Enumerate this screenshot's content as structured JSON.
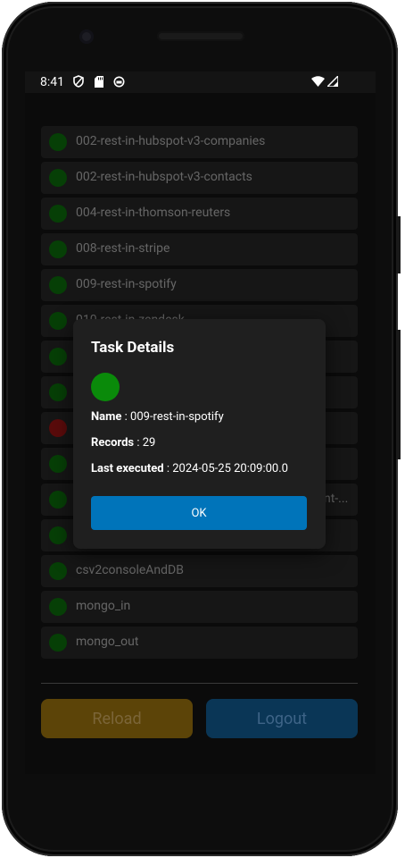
{
  "statusbar": {
    "time": "8:41",
    "icons": [
      "shield-icon",
      "sd-card-icon",
      "cloud-sync-icon",
      "wifi-icon",
      "cell-signal-icon"
    ]
  },
  "tasks": [
    {
      "label": "002-rest-in-hubspot-v3-companies",
      "status": "ok"
    },
    {
      "label": "002-rest-in-hubspot-v3-contacts",
      "status": "ok"
    },
    {
      "label": "004-rest-in-thomson-reuters",
      "status": "ok"
    },
    {
      "label": "008-rest-in-stripe",
      "status": "ok"
    },
    {
      "label": "009-rest-in-spotify",
      "status": "ok"
    },
    {
      "label": "010-rest-in-zendesk",
      "status": "ok"
    },
    {
      "label": "",
      "status": "ok"
    },
    {
      "label": "",
      "status": "ok"
    },
    {
      "label": "",
      "status": "error"
    },
    {
      "label": "",
      "status": "ok"
    },
    {
      "label": "nt-...",
      "status": "ok"
    },
    {
      "label": "",
      "status": "ok"
    },
    {
      "label": "csv2consoleAndDB",
      "status": "ok"
    },
    {
      "label": "mongo_in",
      "status": "ok"
    },
    {
      "label": "mongo_out",
      "status": "ok"
    }
  ],
  "buttons": {
    "reload": "Reload",
    "logout": "Logout"
  },
  "dialog": {
    "title": "Task Details",
    "name_label": "Name",
    "name_value": "009-rest-in-spotify",
    "records_label": "Records",
    "records_value": "29",
    "last_executed_label": "Last executed",
    "last_executed_value": "2024-05-25 20:09:00.0",
    "ok_label": "OK"
  },
  "colors": {
    "status_ok": "#0a8a0a",
    "status_error": "#b01010",
    "reload": "#c98a0e",
    "logout": "#0074ba"
  }
}
